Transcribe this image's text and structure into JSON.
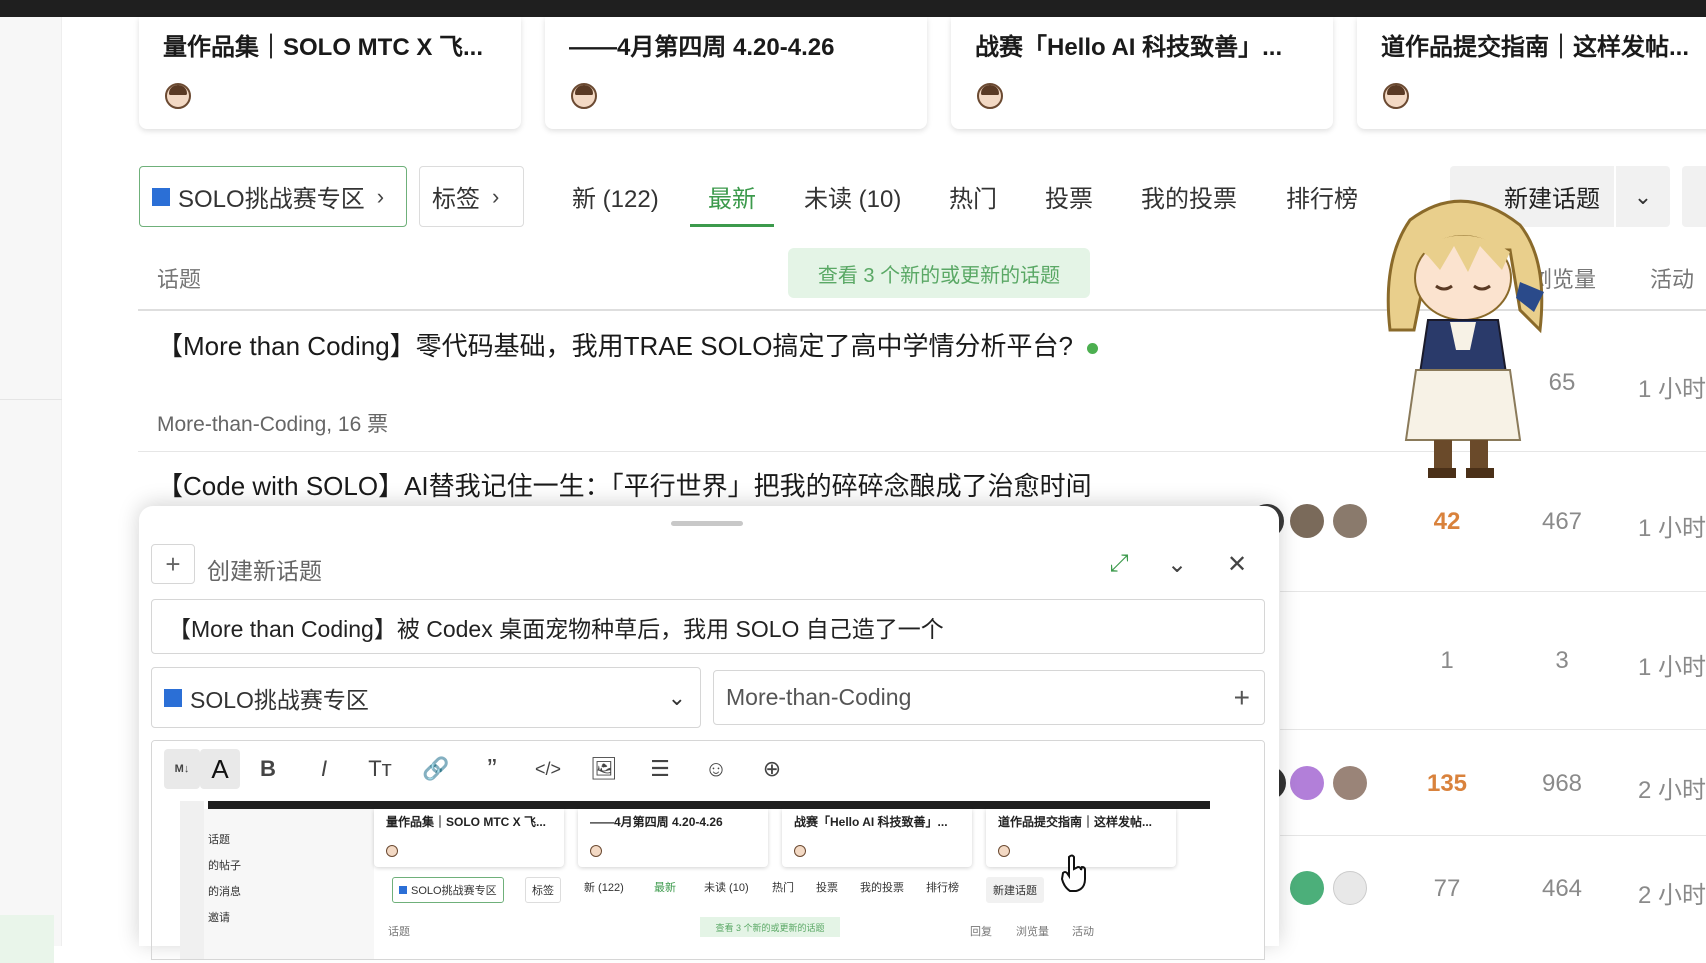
{
  "pinned_cards": [
    {
      "title": "量作品集｜SOLO MTC X 飞..."
    },
    {
      "title": "——4月第四周 4.20-4.26"
    },
    {
      "title": "战赛「Hello AI 科技致善」..."
    },
    {
      "title": "道作品提交指南｜这样发帖..."
    }
  ],
  "filter": {
    "category": "SOLO挑战赛专区",
    "tags": "标签"
  },
  "nav_tabs": [
    "新 (122)",
    "最新",
    "未读 (10)",
    "热门",
    "投票",
    "我的投票",
    "排行榜"
  ],
  "new_topic_label": "新建话题",
  "columns": {
    "topic": "话题",
    "views": "浏览量",
    "activity": "活动"
  },
  "new_banner": "查看 3 个新的或更新的话题",
  "topics": [
    {
      "title": "【More than Coding】零代码基础，我用TRAE SOLO搞定了高中学情分析平台?",
      "meta": "More-than-Coding, 16 票",
      "views": "65",
      "activity": "1 小时"
    },
    {
      "title": "【Code with SOLO】AI替我记住一生：「平行世界」把我的碎碎念酿成了治愈时间",
      "replies": "42",
      "views": "467",
      "activity": "1 小时"
    },
    {
      "replies": "1",
      "views": "3",
      "activity": "1 小时"
    },
    {
      "replies": "135",
      "views": "968",
      "activity": "2 小时"
    },
    {
      "replies": "77",
      "views": "464",
      "activity": "2 小时"
    }
  ],
  "composer": {
    "header": "创建新话题",
    "title_value": "【More than Coding】被 Codex 桌面宠物种草后，我用 SOLO 自己造了一个",
    "category": "SOLO挑战赛专区",
    "tag": "More-than-Coding"
  },
  "preview": {
    "cards": [
      "量作品集｜SOLO MTC X 飞...",
      "——4月第四周 4.20-4.26",
      "战赛「Hello AI 科技致善」...",
      "道作品提交指南｜这样发帖..."
    ],
    "side": [
      "话题",
      "的帖子",
      "的消息",
      "邀请"
    ],
    "category": "SOLO挑战赛专区",
    "tags": "标签",
    "tabs": [
      "新 (122)",
      "最新",
      "未读 (10)",
      "热门",
      "投票",
      "我的投票",
      "排行榜"
    ],
    "new_topic": "新建话题",
    "banner": "查看 3 个新的或更新的话题",
    "cols": [
      "话题",
      "回复",
      "浏览量",
      "活动"
    ]
  },
  "colors": {
    "accent": "#3c9a4c",
    "hot": "#d9823c",
    "category_square": "#2b6fd6"
  }
}
